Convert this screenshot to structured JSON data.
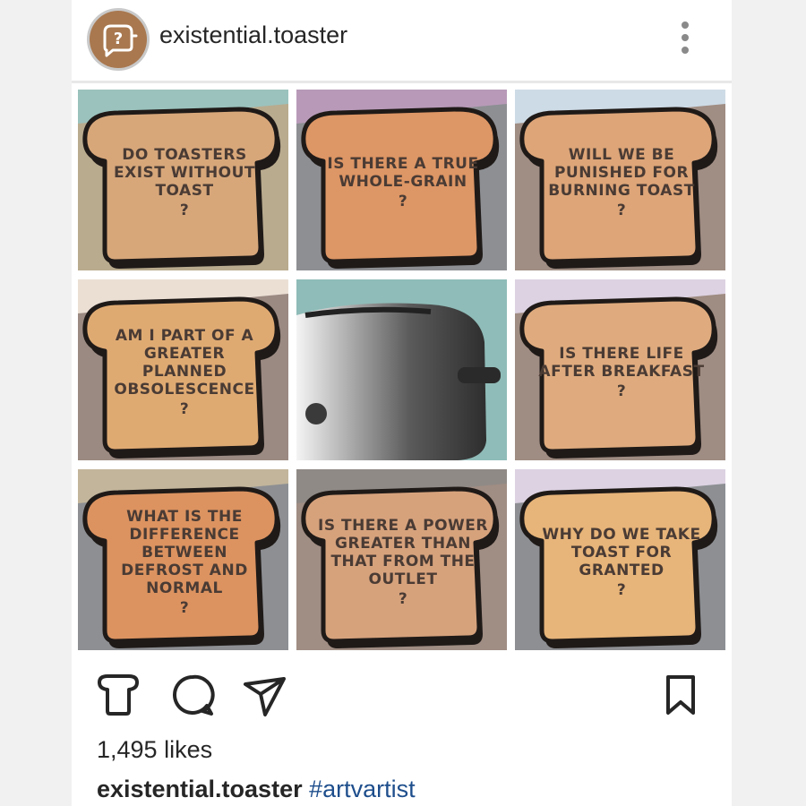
{
  "header": {
    "username": "existential.toaster",
    "avatar_icon": "toaster-question-icon",
    "more_icon": "more-vertical-icon"
  },
  "tiles": [
    {
      "text": "Do toasters exist without toast",
      "mark": "?",
      "top_color": "#9bc2bd",
      "wall_color": "#b9ab8e",
      "bread_color": "#d7a77a"
    },
    {
      "text": "Is there a true whole-grain",
      "mark": "?",
      "top_color": "#b89ab8",
      "wall_color": "#8d8f93",
      "bread_color": "#dd9665"
    },
    {
      "text": "Will we be punished for burning toast",
      "mark": "?",
      "top_color": "#cddbe6",
      "wall_color": "#a08d83",
      "bread_color": "#dda578"
    },
    {
      "text": "Am I part of a greater planned obsolescence",
      "mark": "?",
      "top_color": "#ebdfd4",
      "wall_color": "#9b8a82",
      "bread_color": "#dfaa72"
    },
    {
      "text": "",
      "mark": "",
      "image": "toaster-photo",
      "top_color": "#8fbcb8",
      "wall_color": "#8fbcb8",
      "bread_color": "#888888"
    },
    {
      "text": "Is there life after breakfast",
      "mark": "?",
      "top_color": "#dcd2e2",
      "wall_color": "#9f8c82",
      "bread_color": "#dfab7e"
    },
    {
      "text": "What is the difference between defrost and normal",
      "mark": "?",
      "top_color": "#c2b59b",
      "wall_color": "#8d8f93",
      "bread_color": "#dc9360"
    },
    {
      "text": "Is there a power greater than that from the outlet",
      "mark": "?",
      "top_color": "#908a86",
      "wall_color": "#a08d83",
      "bread_color": "#d6a27c"
    },
    {
      "text": "Why do we take toast for granted",
      "mark": "?",
      "top_color": "#dcd2e2",
      "wall_color": "#8d8f93",
      "bread_color": "#e7b479"
    }
  ],
  "actions": {
    "like_icon": "toast-like-icon",
    "comment_icon": "comment-icon",
    "share_icon": "send-icon",
    "save_icon": "bookmark-icon"
  },
  "likes": "1,495 likes",
  "caption": {
    "username": "existential.toaster",
    "hashtag": "#artvartist"
  }
}
